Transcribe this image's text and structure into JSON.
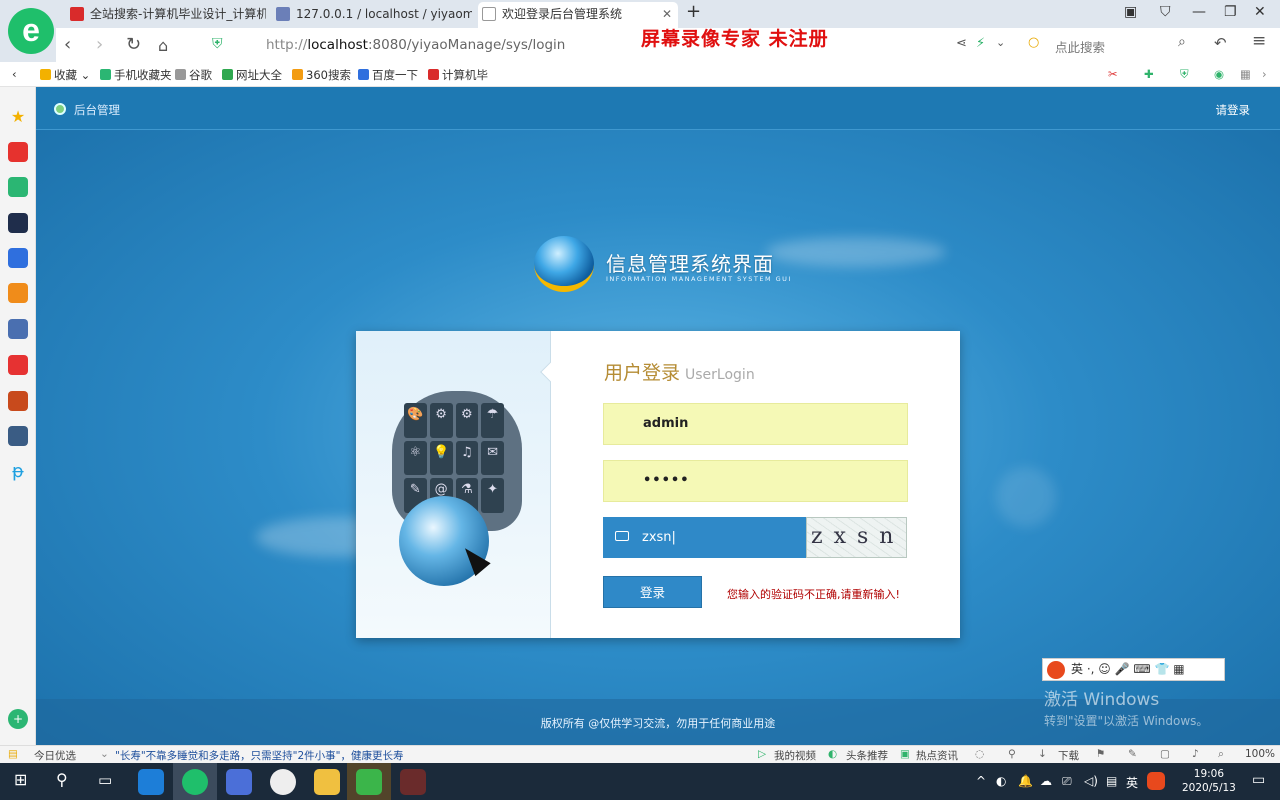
{
  "browser": {
    "tabs": [
      {
        "label": "全站搜索-计算机毕业设计_计算机",
        "icon_color": "#d92b2b"
      },
      {
        "label": "127.0.0.1 / localhost / yiyaoma",
        "icon_color": "#6b7fb8"
      },
      {
        "label": "欢迎登录后台管理系统",
        "icon_color": "#ffffff"
      }
    ],
    "url_prefix": "http://",
    "url_host": "localhost",
    "url_rest": ":8080/yiyaoManage/sys/login",
    "watermark": "屏幕录像专家  未注册",
    "search_placeholder": "点此搜索",
    "bookmarks": [
      {
        "label": "收藏",
        "icon_color": "#f3b100"
      },
      {
        "label": "手机收藏夹",
        "icon_color": "#2bb673"
      },
      {
        "label": "谷歌",
        "icon_color": "#999999"
      },
      {
        "label": "网址大全",
        "icon_color": "#2fa84f"
      },
      {
        "label": "360搜索",
        "icon_color": "#f39c12"
      },
      {
        "label": "百度一下",
        "icon_color": "#2f6fde"
      },
      {
        "label": "计算机毕",
        "icon_color": "#d92b2b"
      }
    ]
  },
  "page": {
    "back_label": "后台管理",
    "login_link": "请登录",
    "brand_title": "信息管理系统界面",
    "brand_subtitle": "INFORMATION MANAGEMENT SYSTEM GUI",
    "login_title": "用户登录",
    "login_title_en": "UserLogin",
    "username_value": "admin",
    "password_value": "•••••",
    "captcha_input_value": "zxsn",
    "captcha_image_text": "zxsn",
    "login_button": "登录",
    "error_message": "您输入的验证码不正确,请重新输入!",
    "copyright": "版权所有 @仅供学习交流，勿用于任何商业用途"
  },
  "overlay": {
    "ime_label": "英 ·, ☺ 🎤 ⌨ 👕 ▦",
    "activate_title": "激活 Windows",
    "activate_sub": "转到\"设置\"以激活 Windows。"
  },
  "statusbar": {
    "left_label": "今日优选",
    "news": "\"长寿\"不靠多睡觉和多走路，只需坚持\"2件小事\"，健康更长寿",
    "items": [
      "我的视频",
      "头条推荐",
      "热点资讯",
      "下载"
    ],
    "zoom": "100%"
  },
  "taskbar": {
    "time": "19:06",
    "date": "2020/5/13",
    "lang": "英"
  }
}
